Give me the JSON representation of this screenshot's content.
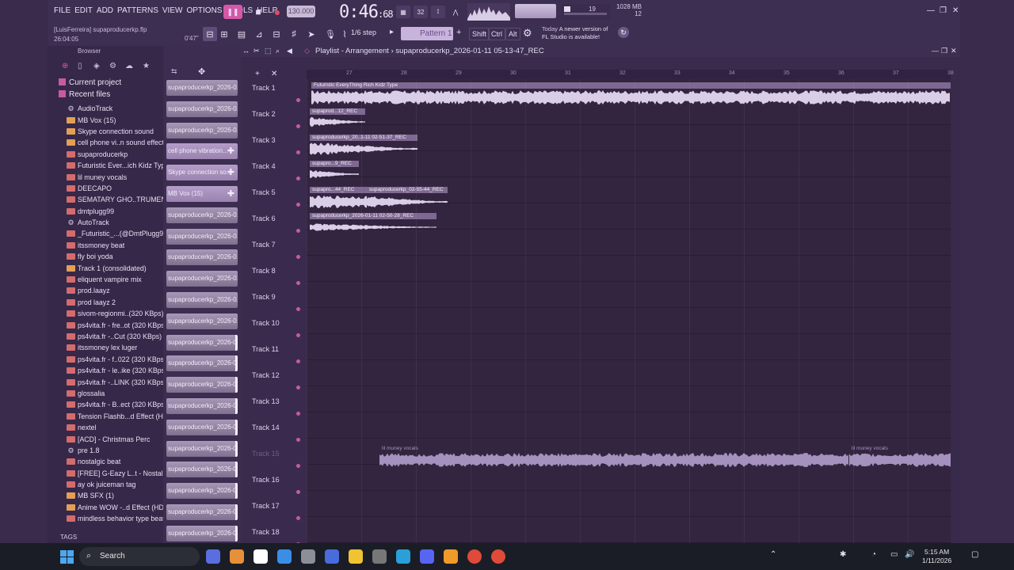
{
  "menu": [
    "FILE",
    "EDIT",
    "ADD",
    "PATTERNS",
    "VIEW",
    "OPTIONS",
    "TOOLS",
    "HELP"
  ],
  "project": {
    "user_file": "[LuisFerreira] supaproducerkp.flp",
    "time_left": "26:04:05",
    "time_right": "0'47\""
  },
  "transport": {
    "bpm": "130.000",
    "time": "0:46",
    "time_sub": ":68",
    "pattern_steps": "32"
  },
  "cpu": {
    "value": "19",
    "mem": "1028 MB",
    "voices": "12"
  },
  "toolbar2": {
    "step": "1/6 step",
    "pattern": "Pattern 1",
    "mod_shift": "Shift",
    "mod_ctrl": "Ctrl",
    "mod_alt": "Alt",
    "news_today": "Today",
    "news_text": "A newer version of",
    "news_text2": "FL Studio is available!"
  },
  "browser": {
    "title": "Browser",
    "current_project": "Current project",
    "recent_files": "Recent files",
    "files": [
      {
        "name": "AudioTrack",
        "icon": "gear"
      },
      {
        "name": "MB Vox (15)",
        "icon": "wav"
      },
      {
        "name": "Skype connection sound",
        "icon": "wav"
      },
      {
        "name": "cell phone vi..n sound effect",
        "icon": "wav"
      },
      {
        "name": "supaproducerkp",
        "icon": "flp"
      },
      {
        "name": "Futuristic Ever...ich Kidz Type",
        "icon": "flp"
      },
      {
        "name": "lil muney vocals",
        "icon": "flp"
      },
      {
        "name": "DEECAPO",
        "icon": "flp"
      },
      {
        "name": "SEMATARY GHO..TRUMENTAL",
        "icon": "flp"
      },
      {
        "name": "dmtplugg99",
        "icon": "flp"
      },
      {
        "name": "AutoTrack",
        "icon": "gear"
      },
      {
        "name": "_Futuristic_...(@DmtPlugg99)",
        "icon": "flp"
      },
      {
        "name": "itssmoney beat",
        "icon": "flp"
      },
      {
        "name": "fly boi yoda",
        "icon": "flp"
      },
      {
        "name": "Track 1 (consolidated)",
        "icon": "wav"
      },
      {
        "name": "eliquent vampire mix",
        "icon": "flp"
      },
      {
        "name": "prod.laayz",
        "icon": "flp"
      },
      {
        "name": "prod laayz 2",
        "icon": "flp"
      },
      {
        "name": "sivom-regionmi..(320 KBps)",
        "icon": "flp"
      },
      {
        "name": "ps4vita.fr - fre..ot (320 KBps)",
        "icon": "flp"
      },
      {
        "name": "ps4vita.fr -..Cut (320 KBps)",
        "icon": "flp"
      },
      {
        "name": "itssmoney lex luger",
        "icon": "flp"
      },
      {
        "name": "ps4vita.fr - f..022 (320 KBps)",
        "icon": "flp"
      },
      {
        "name": "ps4vita.fr - le..ike (320 KBps)",
        "icon": "flp"
      },
      {
        "name": "ps4vita.fr -..LINK (320 KBps)",
        "icon": "flp"
      },
      {
        "name": "glossalia",
        "icon": "flp"
      },
      {
        "name": "ps4vita.fr - B..ect (320 KBps)",
        "icon": "flp"
      },
      {
        "name": "Tension Flashb...d Effect (HD)",
        "icon": "flp"
      },
      {
        "name": "nextel",
        "icon": "flp"
      },
      {
        "name": "[ACD] - Christmas Perc",
        "icon": "flp"
      },
      {
        "name": "pre 1.8",
        "icon": "gear"
      },
      {
        "name": "nostalgic beat",
        "icon": "flp"
      },
      {
        "name": "[FREE] G-Eazy L..t - Nostalgic",
        "icon": "flp"
      },
      {
        "name": "ay ok juiceman tag",
        "icon": "flp"
      },
      {
        "name": "MB SFX (1)",
        "icon": "wav"
      },
      {
        "name": "Anime WOW -..d Effect (HD)",
        "icon": "wav"
      },
      {
        "name": "mindless behavior type beat",
        "icon": "flp"
      }
    ],
    "tags": "TAGS"
  },
  "picker": [
    {
      "label": "supaproducerkp_2026-0...",
      "plus": false,
      "hl": false
    },
    {
      "label": "supaproducerkp_2026-0...",
      "plus": false,
      "hl": false
    },
    {
      "label": "supaproducerkp_2026-0...",
      "plus": false,
      "hl": false
    },
    {
      "label": "cell phone vibration...",
      "plus": true,
      "hl": false
    },
    {
      "label": "Skype connection so...",
      "plus": true,
      "hl": false
    },
    {
      "label": "MB Vox (15)",
      "plus": true,
      "hl": false
    },
    {
      "label": "supaproducerkp_2026-0...",
      "plus": false,
      "hl": false
    },
    {
      "label": "supaproducerkp_2026-0...",
      "plus": false,
      "hl": false
    },
    {
      "label": "supaproducerkp_2026-0...",
      "plus": false,
      "hl": false
    },
    {
      "label": "supaproducerkp_2026-0...",
      "plus": false,
      "hl": false
    },
    {
      "label": "supaproducerkp_2026-0...",
      "plus": false,
      "hl": false
    },
    {
      "label": "supaproducerkp_2026-0...",
      "plus": false,
      "hl": false
    },
    {
      "label": "supaproducerkp_2026-0...",
      "plus": false,
      "hl": true
    },
    {
      "label": "supaproducerkp_2026-0...",
      "plus": false,
      "hl": true
    },
    {
      "label": "supaproducerkp_2026-0...",
      "plus": false,
      "hl": true
    },
    {
      "label": "supaproducerkp_2026-0...",
      "plus": false,
      "hl": true
    },
    {
      "label": "supaproducerkp_2026-0...",
      "plus": false,
      "hl": true
    },
    {
      "label": "supaproducerkp_2026-0...",
      "plus": false,
      "hl": true
    },
    {
      "label": "supaproducerkp_2026-0...",
      "plus": false,
      "hl": true
    },
    {
      "label": "supaproducerkp_2026-0...",
      "plus": false,
      "hl": true
    },
    {
      "label": "supaproducerkp_2026-0...",
      "plus": false,
      "hl": true
    },
    {
      "label": "supaproducerkp_2026-0...",
      "plus": false,
      "hl": true
    }
  ],
  "playlist": {
    "title": "Playlist - Arrangement",
    "pattern_name": "supaproducerkp_2026-01-11 05-13-47_REC",
    "ruler": [
      "27",
      "28",
      "29",
      "30",
      "31",
      "32",
      "33",
      "34",
      "35",
      "36",
      "37",
      "38"
    ],
    "tracks": [
      "Track 1",
      "Track 2",
      "Track 3",
      "Track 4",
      "Track 5",
      "Track 6",
      "Track 7",
      "Track 8",
      "Track 9",
      "Track 10",
      "Track 11",
      "Track 12",
      "Track 13",
      "Track 14",
      "Track 15",
      "Track 16",
      "Track 17",
      "Track 18"
    ],
    "clips": [
      "Futuristic EveryThing Rich Kidz Type",
      "supaprod...12_REC",
      "supaproducerkp_20..1-11 02-51-37_REC",
      "supapro...9_REC",
      "supapro...44_REC",
      "supaproducerkp_02-55-44_REC",
      "supaproducerkp_2026-01-11 02-50-28_REC",
      "lil muney vocals",
      "lil muney vocals"
    ]
  },
  "taskbar": {
    "search": "Search",
    "time": "5:15 AM",
    "date": "1/11/2026"
  }
}
